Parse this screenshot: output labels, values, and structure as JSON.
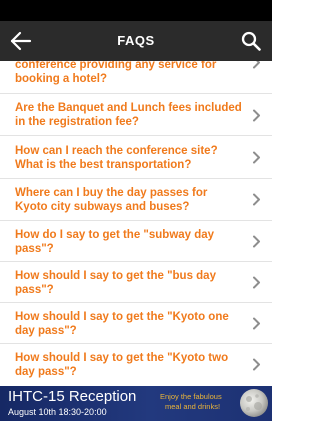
{
  "nav": {
    "title": "FAQS",
    "back_icon": "arrow-left-icon",
    "search_icon": "search-icon"
  },
  "faqs": [
    {
      "question": "conference providing any service for booking a hotel?"
    },
    {
      "question": "Are the Banquet and Lunch fees included in the registration fee?"
    },
    {
      "question": "How can I reach the conference site? What is the best transportation?"
    },
    {
      "question": "Where can I buy the day passes for Kyoto city subways and buses?"
    },
    {
      "question": "How do I say to get the \"subway day pass\"?"
    },
    {
      "question": "How should I say to get the \"bus day pass\"?"
    },
    {
      "question": "How should I say to get the \"Kyoto one day pass\"?"
    },
    {
      "question": "How should I say to get the \"Kyoto two day pass\"?"
    }
  ],
  "banner": {
    "title": "IHTC-15 Reception",
    "subtitle": "August 10th 18:30-20:00",
    "tagline_1": "Enjoy the fabulous",
    "tagline_2": "meal and drinks!",
    "image_icon": "moon-icon"
  },
  "colors": {
    "accent": "#f07a1c",
    "nav_background": "#2b2b2b",
    "banner_background": "#1d3173",
    "banner_highlight": "#e9b43a"
  }
}
